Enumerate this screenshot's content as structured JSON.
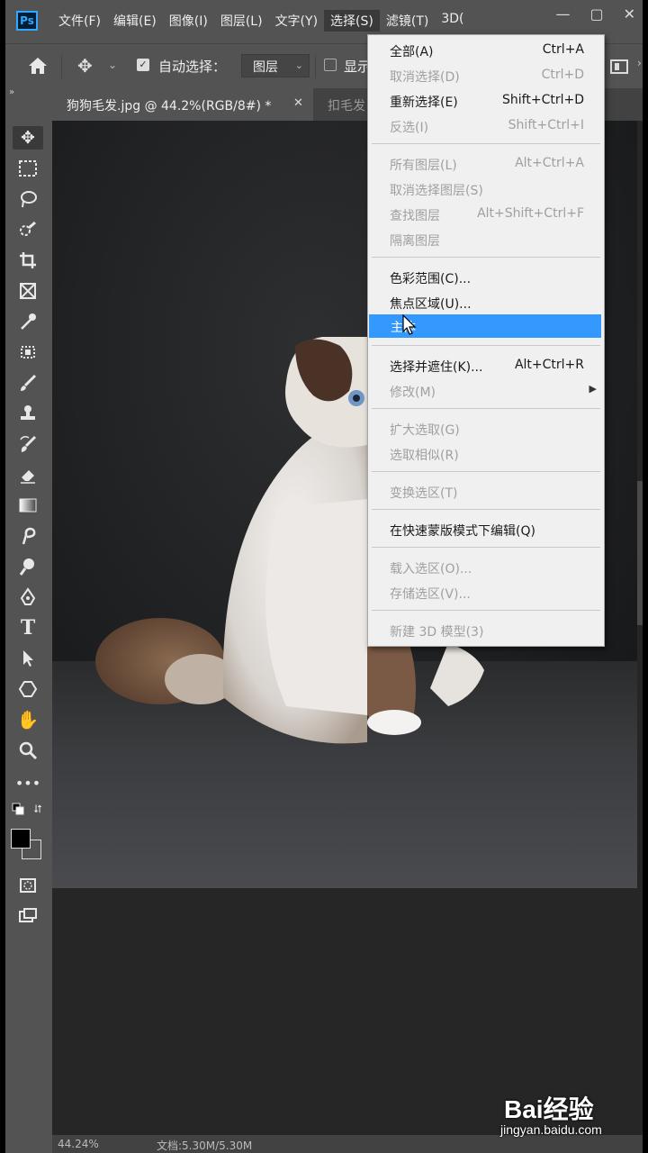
{
  "app": {
    "logo": "Ps"
  },
  "menubar": {
    "items": [
      "文件(F)",
      "编辑(E)",
      "图像(I)",
      "图层(L)",
      "文字(Y)",
      "选择(S)",
      "滤镜(T)",
      "3D("
    ],
    "window_controls": [
      "—",
      "▢",
      "✕"
    ]
  },
  "options": {
    "auto_select_label": "自动选择：",
    "auto_select_value": "图层",
    "show_label": "显示"
  },
  "tabs": {
    "active": "狗狗毛发.jpg @ 44.2%(RGB/8#) *",
    "inactive": "扣毛发"
  },
  "select_menu": {
    "items": [
      {
        "label": "全部(A)",
        "shortcut": "Ctrl+A",
        "enabled": true
      },
      {
        "label": "取消选择(D)",
        "shortcut": "Ctrl+D",
        "enabled": false
      },
      {
        "label": "重新选择(E)",
        "shortcut": "Shift+Ctrl+D",
        "enabled": true
      },
      {
        "label": "反选(I)",
        "shortcut": "Shift+Ctrl+I",
        "enabled": false
      },
      {
        "label": "所有图层(L)",
        "shortcut": "Alt+Ctrl+A",
        "enabled": false
      },
      {
        "label": "取消选择图层(S)",
        "shortcut": "",
        "enabled": false
      },
      {
        "label": "查找图层",
        "shortcut": "Alt+Shift+Ctrl+F",
        "enabled": false
      },
      {
        "label": "隔离图层",
        "shortcut": "",
        "enabled": false
      },
      {
        "label": "色彩范围(C)...",
        "shortcut": "",
        "enabled": true
      },
      {
        "label": "焦点区域(U)...",
        "shortcut": "",
        "enabled": true
      },
      {
        "label": "主体",
        "shortcut": "",
        "enabled": true,
        "highlighted": true
      },
      {
        "label": "选择并遮住(K)...",
        "shortcut": "Alt+Ctrl+R",
        "enabled": true
      },
      {
        "label": "修改(M)",
        "shortcut": "",
        "enabled": false,
        "submenu": true
      },
      {
        "label": "扩大选取(G)",
        "shortcut": "",
        "enabled": false
      },
      {
        "label": "选取相似(R)",
        "shortcut": "",
        "enabled": false
      },
      {
        "label": "变换选区(T)",
        "shortcut": "",
        "enabled": false
      },
      {
        "label": "在快速蒙版模式下编辑(Q)",
        "shortcut": "",
        "enabled": true
      },
      {
        "label": "载入选区(O)...",
        "shortcut": "",
        "enabled": false
      },
      {
        "label": "存储选区(V)...",
        "shortcut": "",
        "enabled": false
      },
      {
        "label": "新建 3D 模型(3)",
        "shortcut": "",
        "enabled": false
      }
    ]
  },
  "status": {
    "zoom": "44.24%",
    "doc": "文档:5.30M/5.30M"
  },
  "watermark": {
    "main": "Bai经验",
    "url": "jingyan.baidu.com"
  },
  "colors": {
    "highlight": "#3399ff",
    "menu_bg": "#f0f0f0",
    "ui_bg": "#535353",
    "accent": "#31a8ff"
  }
}
